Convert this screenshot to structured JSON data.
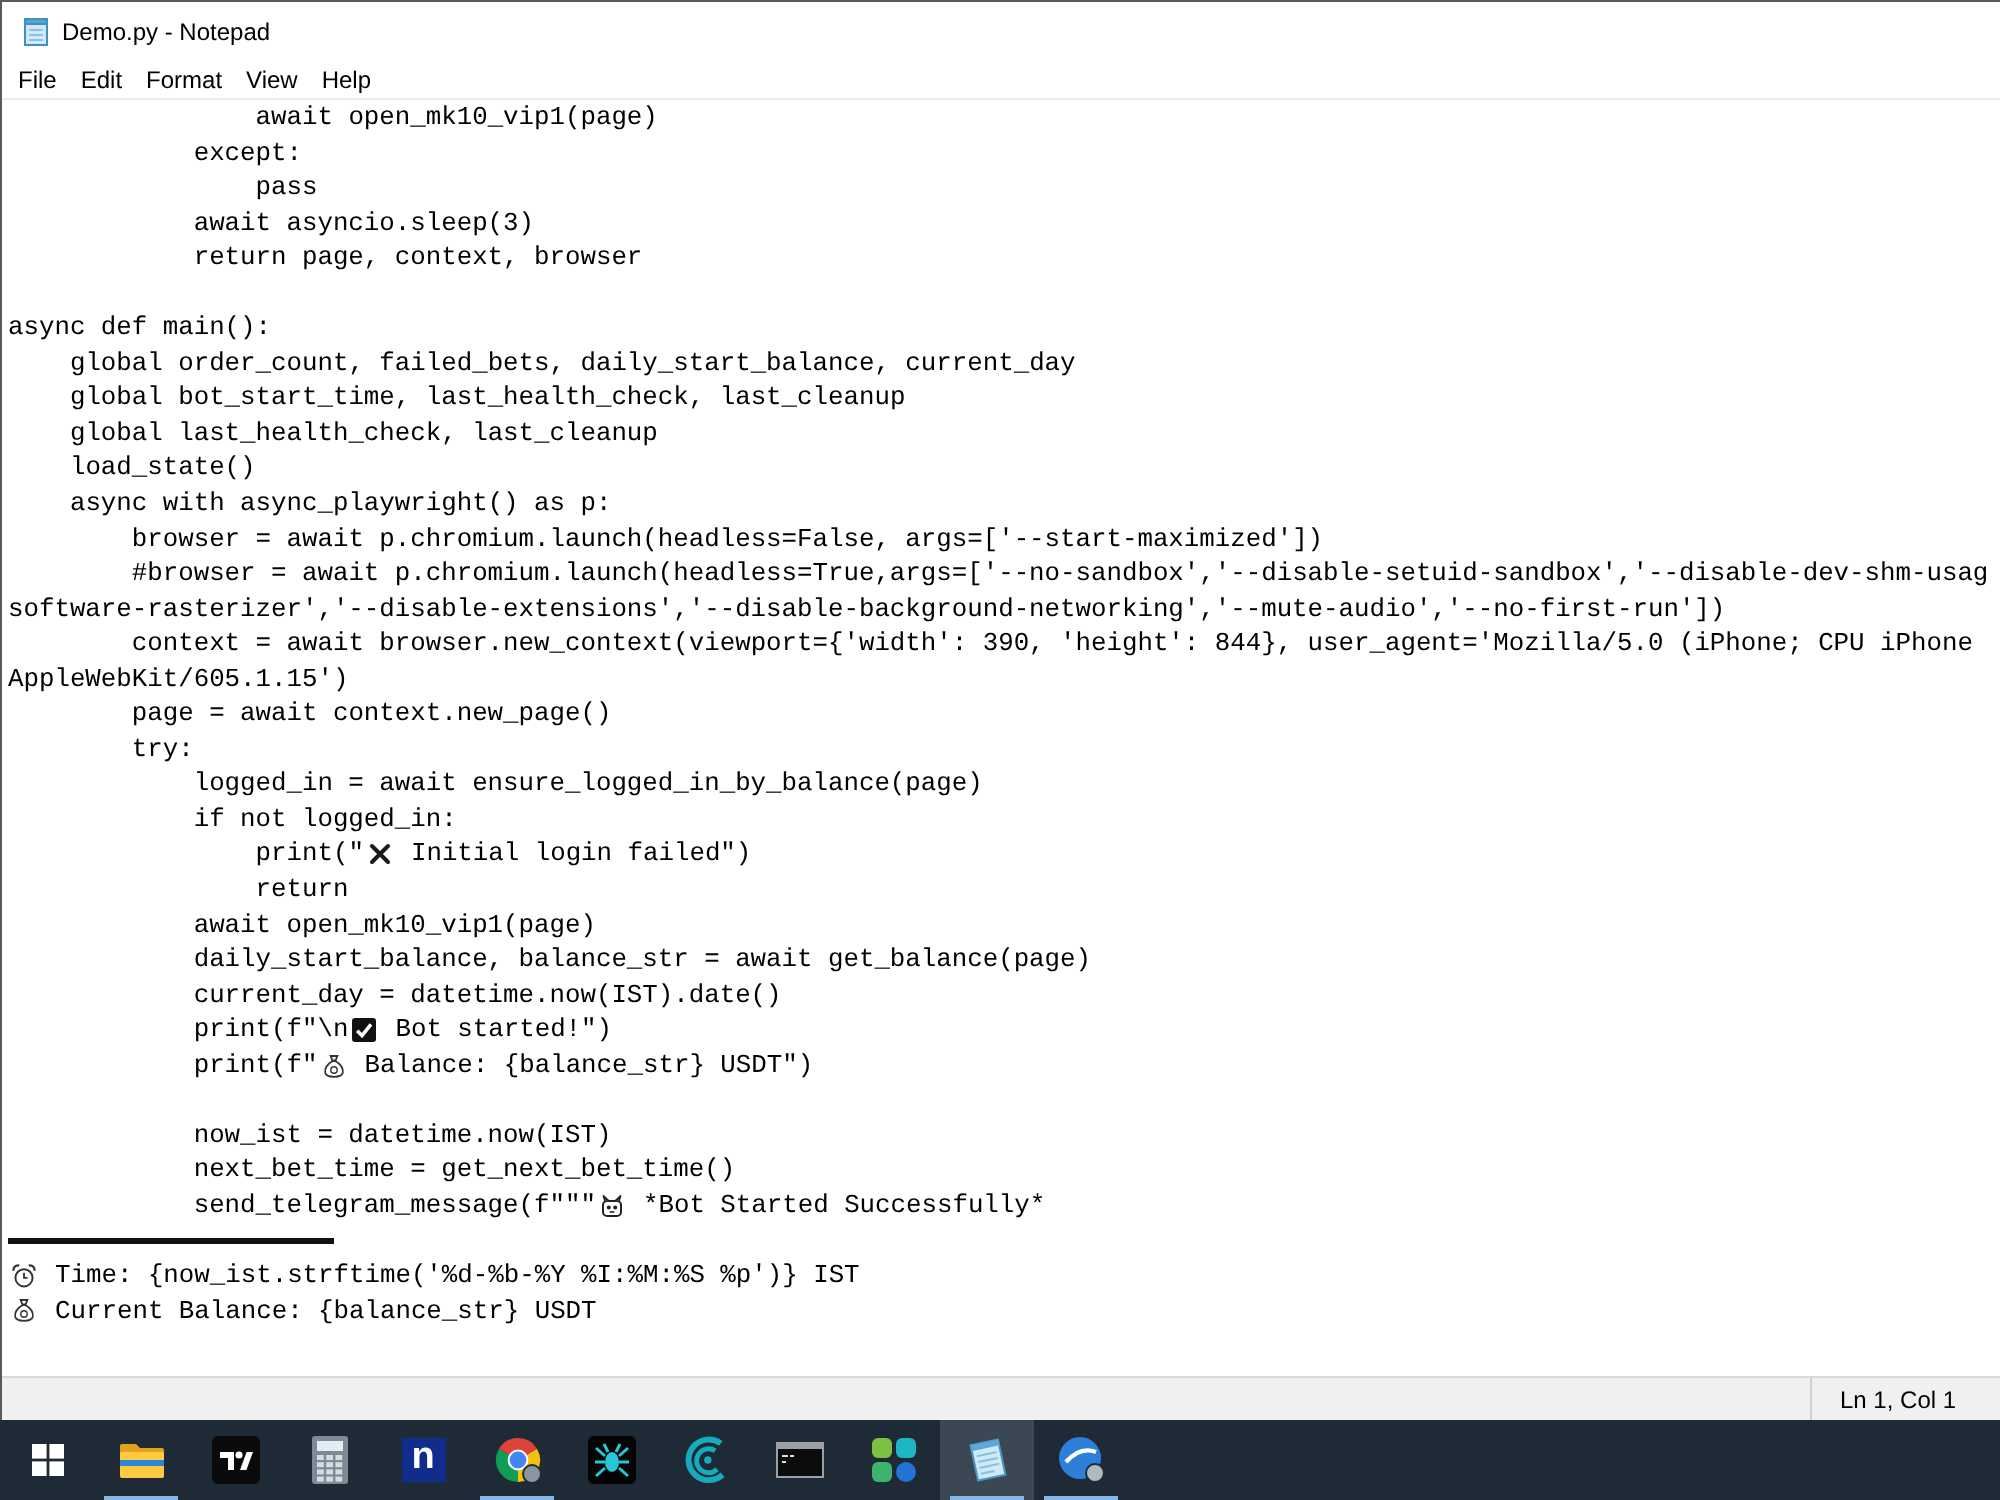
{
  "window": {
    "title": "Demo.py - Notepad"
  },
  "menu": [
    "File",
    "Edit",
    "Format",
    "View",
    "Help"
  ],
  "editor": {
    "lines": [
      {
        "kind": "code",
        "text": "                await open_mk10_vip1(page)"
      },
      {
        "kind": "code",
        "text": "            except:"
      },
      {
        "kind": "code",
        "text": "                pass"
      },
      {
        "kind": "code",
        "text": "            await asyncio.sleep(3)"
      },
      {
        "kind": "code",
        "text": "            return page, context, browser"
      },
      {
        "kind": "blank"
      },
      {
        "kind": "code",
        "text": "async def main():"
      },
      {
        "kind": "code",
        "text": "    global order_count, failed_bets, daily_start_balance, current_day"
      },
      {
        "kind": "code",
        "text": "    global bot_start_time, last_health_check, last_cleanup"
      },
      {
        "kind": "code",
        "text": "    global last_health_check, last_cleanup"
      },
      {
        "kind": "code",
        "text": "    load_state()"
      },
      {
        "kind": "code",
        "text": "    async with async_playwright() as p:"
      },
      {
        "kind": "code",
        "text": "        browser = await p.chromium.launch(headless=False, args=['--start-maximized'])"
      },
      {
        "kind": "code",
        "text": "        #browser = await p.chromium.launch(headless=True,args=['--no-sandbox','--disable-setuid-sandbox','--disable-dev-shm-usag"
      },
      {
        "kind": "code",
        "text": "software-rasterizer','--disable-extensions','--disable-background-networking','--mute-audio','--no-first-run'])"
      },
      {
        "kind": "code",
        "text": "        context = await browser.new_context(viewport={'width': 390, 'height': 844}, user_agent='Mozilla/5.0 (iPhone; CPU iPhone"
      },
      {
        "kind": "code",
        "text": "AppleWebKit/605.1.15')"
      },
      {
        "kind": "code",
        "text": "        page = await context.new_page()"
      },
      {
        "kind": "code",
        "text": "        try:"
      },
      {
        "kind": "code",
        "text": "            logged_in = await ensure_logged_in_by_balance(page)"
      },
      {
        "kind": "code",
        "text": "            if not logged_in:"
      },
      {
        "kind": "mixed",
        "parts": [
          {
            "kind": "text",
            "text": "                print(\""
          },
          {
            "kind": "cross"
          },
          {
            "kind": "text",
            "text": " Initial login failed\")"
          }
        ]
      },
      {
        "kind": "code",
        "text": "                return"
      },
      {
        "kind": "code",
        "text": "            await open_mk10_vip1(page)"
      },
      {
        "kind": "code",
        "text": "            daily_start_balance, balance_str = await get_balance(page)"
      },
      {
        "kind": "code",
        "text": "            current_day = datetime.now(IST).date()"
      },
      {
        "kind": "mixed",
        "parts": [
          {
            "kind": "text",
            "text": "            print(f\"\\n"
          },
          {
            "kind": "check"
          },
          {
            "kind": "text",
            "text": " Bot started!\")"
          }
        ]
      },
      {
        "kind": "mixed",
        "parts": [
          {
            "kind": "text",
            "text": "            print(f\""
          },
          {
            "kind": "moneybag"
          },
          {
            "kind": "text",
            "text": " Balance: {balance_str} USDT\")"
          }
        ]
      },
      {
        "kind": "blank"
      },
      {
        "kind": "code",
        "text": "            now_ist = datetime.now(IST)"
      },
      {
        "kind": "code",
        "text": "            next_bet_time = get_next_bet_time()"
      },
      {
        "kind": "mixed",
        "parts": [
          {
            "kind": "text",
            "text": "            send_telegram_message(f\"\"\""
          },
          {
            "kind": "robot"
          },
          {
            "kind": "text",
            "text": " *Bot Started Successfully*"
          }
        ]
      },
      {
        "kind": "rule"
      },
      {
        "kind": "mixed",
        "parts": [
          {
            "kind": "clock"
          },
          {
            "kind": "text",
            "text": " Time: {now_ist.strftime('%d-%b-%Y %I:%M:%S %p')} IST"
          }
        ]
      },
      {
        "kind": "mixed",
        "parts": [
          {
            "kind": "moneybag"
          },
          {
            "kind": "text",
            "text": " Current Balance: {balance_str} USDT"
          }
        ]
      },
      {
        "kind": "blank"
      }
    ]
  },
  "status_bar": {
    "position": "Ln 1, Col 1"
  },
  "taskbar": {
    "items": [
      {
        "kind": "start",
        "selected": false,
        "running": false
      },
      {
        "kind": "folder",
        "selected": false,
        "running": true
      },
      {
        "kind": "tile",
        "selected": false,
        "running": false
      },
      {
        "kind": "calculator",
        "selected": false,
        "running": false
      },
      {
        "kind": "letter",
        "text": "n",
        "selected": false,
        "running": false
      },
      {
        "kind": "browser",
        "selected": false,
        "running": true
      },
      {
        "kind": "bug",
        "selected": false,
        "running": false
      },
      {
        "kind": "wave",
        "selected": false,
        "running": false
      },
      {
        "kind": "terminal",
        "selected": false,
        "running": false
      },
      {
        "kind": "blocks",
        "selected": false,
        "running": false
      },
      {
        "kind": "notepad",
        "selected": true,
        "running": true
      },
      {
        "kind": "disc",
        "selected": false,
        "running": true
      }
    ]
  }
}
